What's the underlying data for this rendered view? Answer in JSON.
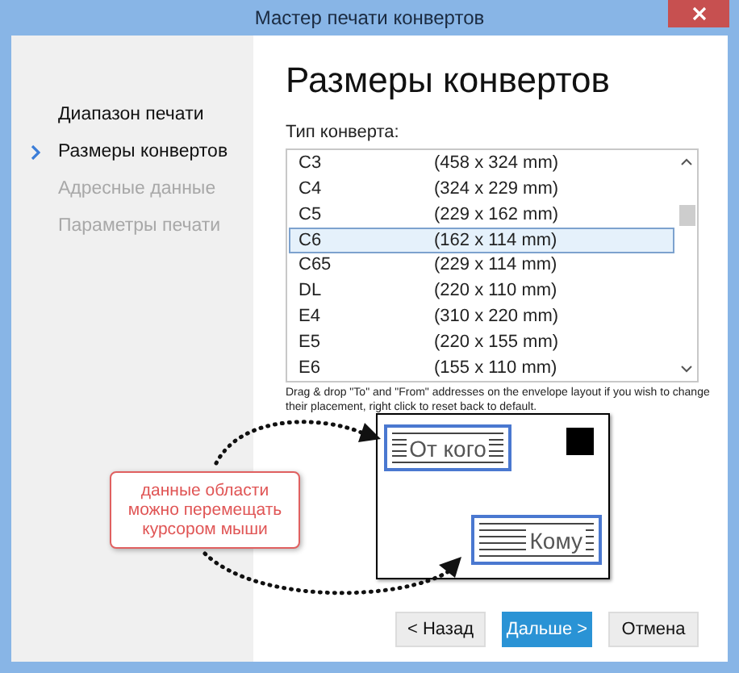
{
  "window": {
    "title": "Мастер печати конвертов"
  },
  "steps": [
    {
      "label": "Диапазон печати",
      "selected": false,
      "disabled": false
    },
    {
      "label": "Размеры конвертов",
      "selected": true,
      "disabled": false
    },
    {
      "label": "Адресные данные",
      "selected": false,
      "disabled": true
    },
    {
      "label": "Параметры печати",
      "selected": false,
      "disabled": true
    }
  ],
  "heading": "Размеры конвертов",
  "envelope_type": {
    "label": "Тип конверта:",
    "items": [
      {
        "name": "C3",
        "size": "(458 x 324 mm)",
        "selected": false
      },
      {
        "name": "C4",
        "size": "(324 x 229 mm)",
        "selected": false
      },
      {
        "name": "C5",
        "size": "(229 x 162 mm)",
        "selected": false
      },
      {
        "name": "C6",
        "size": "(162 x 114 mm)",
        "selected": true
      },
      {
        "name": "C65",
        "size": "(229 x 114 mm)",
        "selected": false
      },
      {
        "name": "DL",
        "size": "(220 x 110 mm)",
        "selected": false
      },
      {
        "name": "E4",
        "size": "(310 x 220 mm)",
        "selected": false
      },
      {
        "name": "E5",
        "size": "(220 x 155 mm)",
        "selected": false
      },
      {
        "name": "E6",
        "size": "(155 x 110 mm)",
        "selected": false
      }
    ]
  },
  "hint": "Drag & drop \"To\" and \"From\" addresses on the envelope layout if you wish to change their placement, right click to reset back to default.",
  "layout": {
    "from": "От кого",
    "to": "Кому"
  },
  "callout": "данные области можно перемещать курсором мыши",
  "buttons": [
    {
      "label": "< Назад",
      "kind": "secondary"
    },
    {
      "label": "Дальше >",
      "kind": "primary"
    },
    {
      "label": "Отмена",
      "kind": "secondary"
    }
  ]
}
